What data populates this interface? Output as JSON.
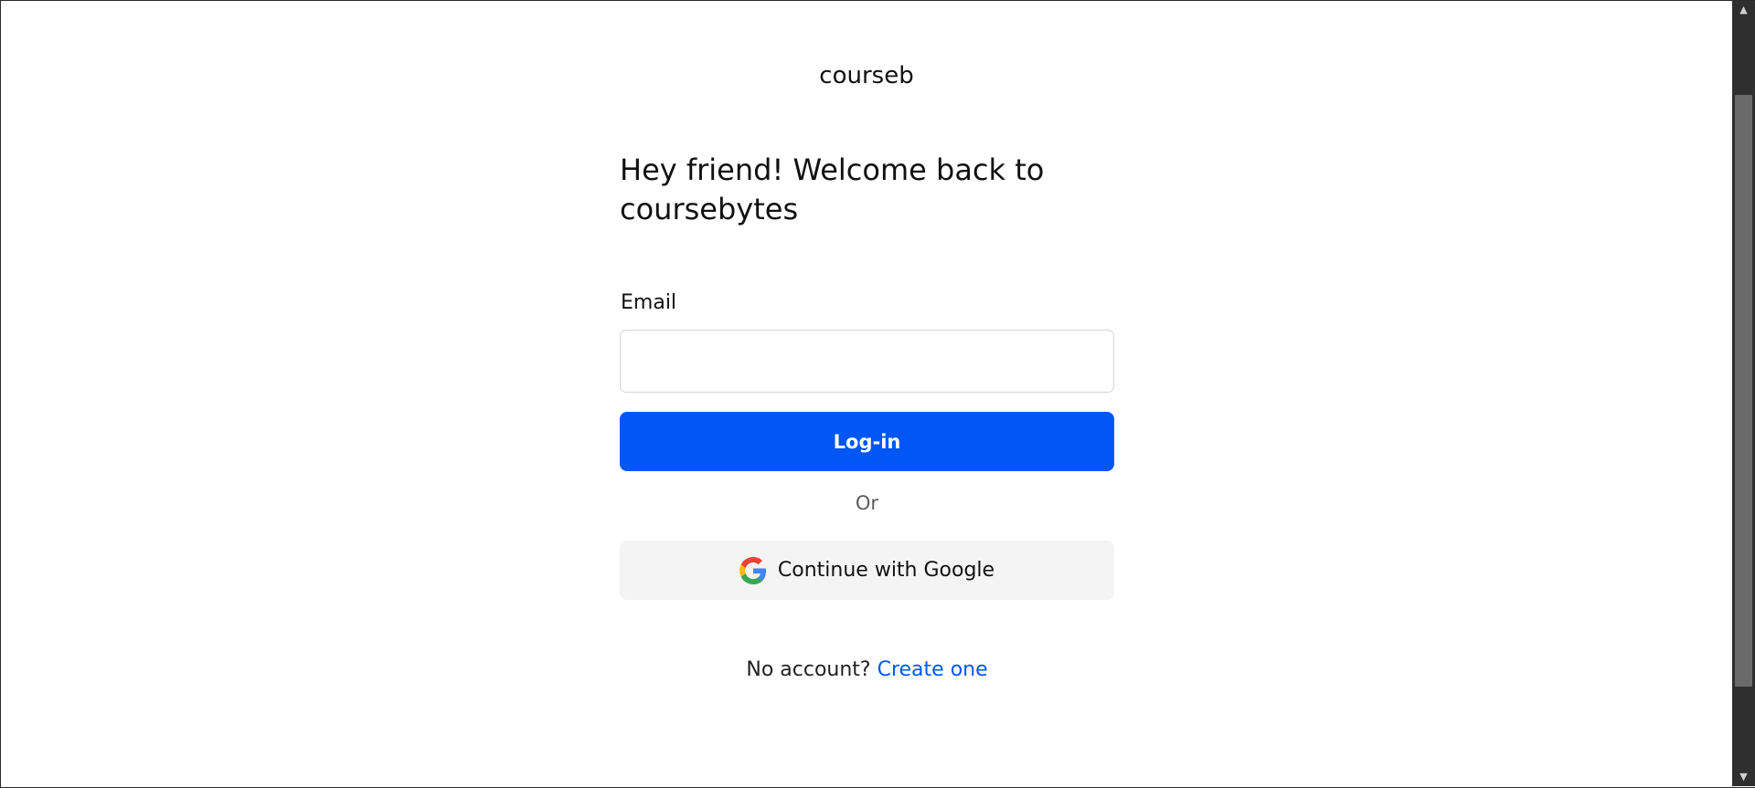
{
  "brand": {
    "name": "courseb"
  },
  "login": {
    "heading": "Hey friend! Welcome back to coursebytes",
    "email_label": "Email",
    "email_value": "",
    "email_placeholder": "",
    "login_button": "Log-in",
    "or_text": "Or",
    "google_button": "Continue with Google",
    "no_account_text": "No account?",
    "create_link": "Create one"
  },
  "colors": {
    "accent": "#0057f5",
    "google_button_bg": "#f4f4f4"
  },
  "scrollbar": {
    "up_icon": "triangle-up-icon",
    "down_icon": "triangle-down-icon"
  }
}
